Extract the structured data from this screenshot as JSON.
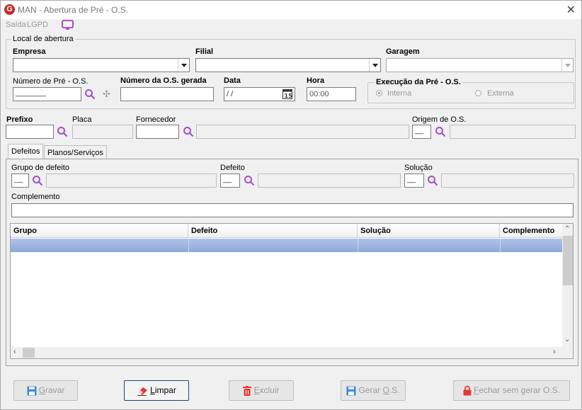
{
  "window": {
    "title": "MAN - Abertura de Pré - O.S.",
    "logo_letter": "G"
  },
  "menu": {
    "items": [
      "Saída",
      "LGPD"
    ]
  },
  "local": {
    "group_title": "Local de abertura",
    "empresa_label": "Empresa",
    "filial_label": "Filial",
    "garagem_label": "Garagem",
    "num_pre_os_label": "Número de Pré - O.S.",
    "num_pre_os_value": "_______",
    "num_os_gerada_label": "Número da O.S. gerada",
    "data_label": "Data",
    "data_value": " /  /",
    "hora_label": "Hora",
    "hora_value": "00:00",
    "execucao_title": "Execução da Pré - O.S.",
    "interna_label": "Interna",
    "externa_label": "Externa",
    "execucao_selected": "Interna"
  },
  "vehicle": {
    "prefixo_label": "Prefixo",
    "placa_label": "Placa",
    "fornecedor_label": "Fornecedor",
    "origem_label": "Origem de O.S.",
    "origem_value": "__"
  },
  "tabs": [
    {
      "label": "Defeitos",
      "active": true
    },
    {
      "label": "Planos/Serviços",
      "active": false
    }
  ],
  "defeitos": {
    "grupo_label": "Grupo de defeito",
    "grupo_value": "__",
    "defeito_label": "Defeito",
    "defeito_value": "__",
    "solucao_label": "Solução",
    "solucao_value": "__",
    "complemento_label": "Complemento"
  },
  "grid": {
    "columns": [
      "Grupo",
      "Defeito",
      "Solução",
      "Complemento"
    ]
  },
  "buttons": {
    "gravar": {
      "pre": "",
      "key": "G",
      "post": "ravar"
    },
    "limpar": {
      "pre": "",
      "key": "L",
      "post": "impar"
    },
    "excluir": {
      "pre": "",
      "key": "E",
      "post": "xcluir"
    },
    "gerar_os": {
      "pre": "Gerar ",
      "key": "O",
      "post": ".S."
    },
    "fechar": {
      "pre": "",
      "key": "F",
      "post": "echar sem gerar O.S."
    }
  },
  "colors": {
    "accent": "#c62828",
    "search_icon": "#a24fd1",
    "selection": "#9db4e0",
    "disabled_text": "#9a9a9a"
  }
}
